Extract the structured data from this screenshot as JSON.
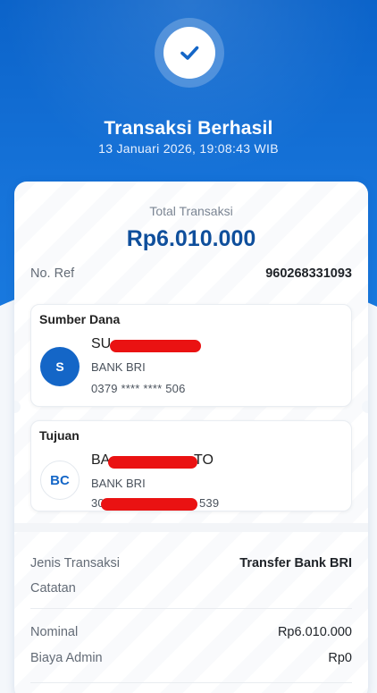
{
  "header": {
    "status_title": "Transaksi Berhasil",
    "datetime": "13 Januari 2026, 19:08:43 WIB",
    "status_icon": "check-icon"
  },
  "summary": {
    "total_label": "Total Transaksi",
    "total_amount": "Rp6.010.000",
    "ref_label": "No. Ref",
    "ref_value": "960268331093"
  },
  "source": {
    "heading": "Sumber Dana",
    "avatar_initial": "S",
    "name_visible": "SU",
    "bank": "BANK BRI",
    "account_number": "0379 **** **** 506"
  },
  "destination": {
    "heading": "Tujuan",
    "avatar_initial": "BC",
    "name_prefix": "BA",
    "name_suffix": "TO",
    "bank": "BANK BRI",
    "account_prefix": "30",
    "account_suffix": "539"
  },
  "details": {
    "type_label": "Jenis Transaksi",
    "type_value": "Transfer Bank BRI",
    "note_label": "Catatan",
    "nominal_label": "Nominal",
    "nominal_value": "Rp6.010.000",
    "fee_label": "Biaya Admin",
    "fee_value": "Rp0"
  },
  "colors": {
    "primary": "#1673d9",
    "amount": "#0f4f9c",
    "redaction": "#ea1212"
  }
}
